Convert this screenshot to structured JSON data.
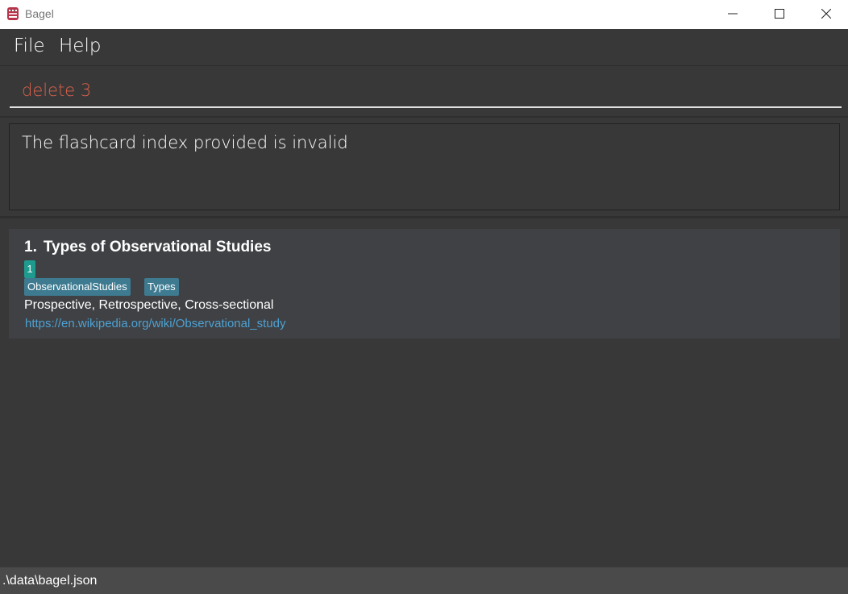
{
  "window": {
    "title": "Bagel",
    "icon": "bagel-app-icon"
  },
  "menu": {
    "items": [
      {
        "label": "File"
      },
      {
        "label": "Help"
      }
    ]
  },
  "command": {
    "value": "delete 3"
  },
  "result": {
    "text": "The flashcard index provided is invalid"
  },
  "flashcards": [
    {
      "index": "1.",
      "title": "Types of Observational Studies",
      "rating": "1",
      "tags": [
        "ObservationalStudies",
        "Types"
      ],
      "answer": "Prospective, Retrospective, Cross-sectional",
      "link": "https://en.wikipedia.org/wiki/Observational_study"
    }
  ],
  "status": {
    "path": ".\\data\\bagel.json"
  },
  "colors": {
    "background": "#383838",
    "command_text": "#d9604c",
    "card_background": "#3f4144",
    "rating_badge": "#1e9a8e",
    "tag": "#3e7b91",
    "link": "#4ea1d3"
  }
}
